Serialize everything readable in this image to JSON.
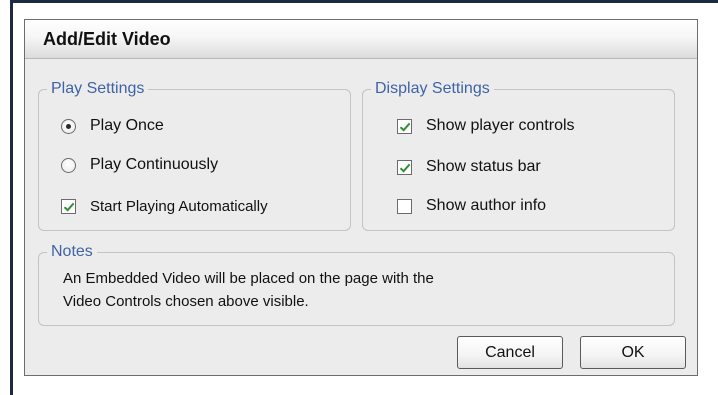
{
  "dialog": {
    "title": "Add/Edit Video",
    "play_settings": {
      "legend": "Play Settings",
      "play_once_label": "Play Once",
      "play_continuously_label": "Play Continuously",
      "start_automatically_label": "Start Playing Automatically",
      "selected_mode": "Play Once",
      "start_automatically_checked": true
    },
    "display_settings": {
      "legend": "Display Settings",
      "show_player_controls_label": "Show player controls",
      "show_status_bar_label": "Show status bar",
      "show_author_info_label": "Show author info",
      "show_player_controls_checked": true,
      "show_status_bar_checked": true,
      "show_author_info_checked": false
    },
    "notes": {
      "legend": "Notes",
      "line1": "An Embedded Video will be placed on the page with the",
      "line2": "Video Controls chosen above visible."
    },
    "buttons": {
      "cancel_label": "Cancel",
      "ok_label": "OK"
    }
  },
  "colors": {
    "frame": "#1e2a44",
    "dialog_background": "#ececec",
    "legend_text": "#3f63a8",
    "check_mark": "#2f8f2f"
  },
  "icons": {
    "radio_selected": "radio-selected-icon",
    "radio_unselected": "radio-unselected-icon",
    "checkbox_checked": "checkbox-checked-icon",
    "checkbox_unchecked": "checkbox-unchecked-icon"
  }
}
